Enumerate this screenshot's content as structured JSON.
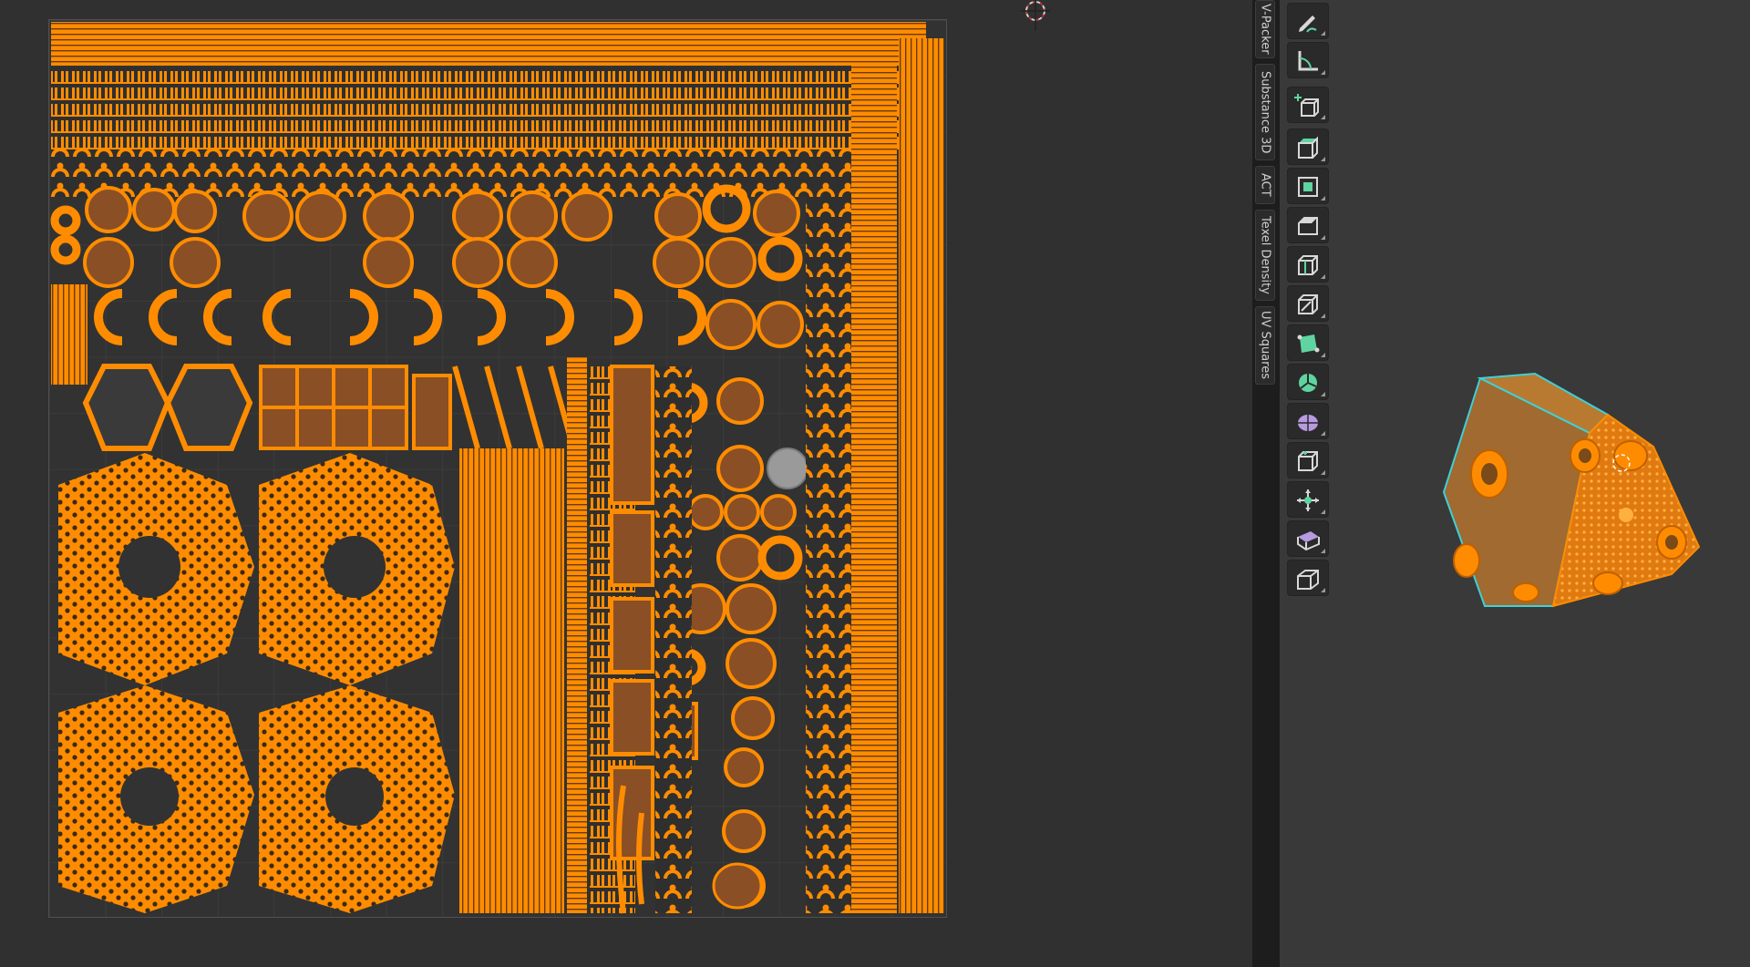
{
  "sidebar": {
    "tabs": [
      {
        "label": "V-Packer"
      },
      {
        "label": "Substance 3D"
      },
      {
        "label": "ACT"
      },
      {
        "label": "Texel Density"
      },
      {
        "label": "UV Squares"
      }
    ]
  },
  "toolbar": {
    "tools": [
      {
        "icon": "annotate-pencil-icon"
      },
      {
        "icon": "measure-ruler-icon"
      },
      {
        "icon": "add-cube-icon"
      },
      {
        "icon": "extrude-region-icon"
      },
      {
        "icon": "inset-faces-icon"
      },
      {
        "icon": "bevel-icon"
      },
      {
        "icon": "loop-cut-icon"
      },
      {
        "icon": "knife-icon"
      },
      {
        "icon": "poly-build-icon"
      },
      {
        "icon": "spin-icon"
      },
      {
        "icon": "smooth-vertices-icon"
      },
      {
        "icon": "edge-slide-icon"
      },
      {
        "icon": "shrink-fatten-icon"
      },
      {
        "icon": "shear-icon"
      },
      {
        "icon": "rip-region-icon"
      }
    ]
  },
  "colors": {
    "uv_island": "#ff8c00",
    "uv_island_fill": "#8a4f25",
    "editor_bg": "#303030",
    "viewport_bg": "#393939",
    "selection_outline": "#3fd0d8",
    "active_tool": "#5fd4a0"
  }
}
